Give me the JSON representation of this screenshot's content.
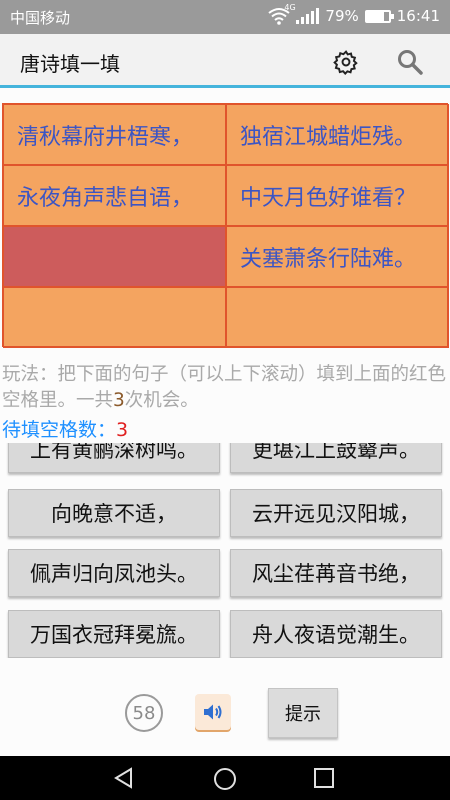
{
  "status_bar": {
    "carrier": "中国移动",
    "network": "4G",
    "battery": "79%",
    "battery_level": 0.79,
    "time": "16:41"
  },
  "header": {
    "title": "唐诗填一填",
    "icons": [
      "gear-icon",
      "search-icon"
    ]
  },
  "poem_grid": [
    {
      "text": "清秋幕府井梧寒，",
      "state": "filled"
    },
    {
      "text": "独宿江城蜡炬残。",
      "state": "filled"
    },
    {
      "text": "永夜角声悲自语，",
      "state": "filled"
    },
    {
      "text": "中天月色好谁看？",
      "state": "filled"
    },
    {
      "text": "",
      "state": "target"
    },
    {
      "text": "关塞萧条行陆难。",
      "state": "filled"
    },
    {
      "text": "",
      "state": "empty"
    },
    {
      "text": "",
      "state": "empty"
    }
  ],
  "instructions": {
    "prefix": "玩法：把下面的句子（可以上下滚动）填到上面的红色空格里。一共",
    "chances": "3",
    "suffix": "次机会。"
  },
  "remaining": {
    "label": "待填空格数：",
    "count": "3"
  },
  "candidates": [
    "上有黄鹂深树鸣。",
    "更堪江上鼓鼙声。",
    "向晚意不适，",
    "云开远见汉阳城，",
    "佩声归向凤池头。",
    "风尘荏苒音书绝，",
    "万国衣冠拜冕旒。",
    "舟人夜语觉潮生。"
  ],
  "controls": {
    "timer": "58",
    "hint_label": "提示",
    "sound_icon": "speaker-icon"
  },
  "colors": {
    "grid_bg": "#f4a460",
    "target_cell": "#cd5c5c",
    "poem_text": "#3c55c4",
    "accent_line": "#45b4dc"
  }
}
